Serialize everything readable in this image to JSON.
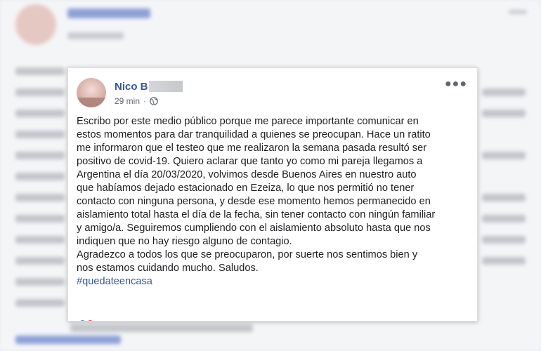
{
  "post": {
    "author": "Nico B",
    "timestamp": "29 min",
    "separator": "·",
    "audience_icon": "globe-icon",
    "more_icon": "more-options-icon",
    "body": {
      "paragraph1_lines": [
        "Escribo por este medio público porque me parece importante comunicar en",
        "estos momentos para dar tranquilidad a quienes se preocupan. Hace un ratito",
        "me informaron que el testeo que me realizaron la semana pasada resultó ser",
        "positivo de covid-19. Quiero aclarar que tanto yo como mi pareja llegamos a",
        "Argentina el día 20/03/2020, volvimos desde Buenos Aires en nuestro auto",
        "que habíamos dejado estacionado en Ezeiza, lo que nos permitió no tener",
        "contacto con ninguna persona, y desde ese momento hemos permanecido en",
        "aislamiento total hasta el día de la fecha, sin tener contacto con ningún familiar",
        "y amigo/a. Seguiremos cumpliendo con el aislamiento absoluto hasta que nos",
        "indiquen que no hay riesgo alguno de contagio."
      ],
      "paragraph2_lines": [
        "Agradezco a todos los que se preocuparon, por suerte nos sentimos bien y",
        "nos estamos cuidando mucho. Saludos."
      ],
      "hashtag": "#quedateencasa"
    }
  },
  "colors": {
    "author": "#365899",
    "hashtag": "#385898",
    "text": "#1c1e21",
    "meta": "#606770"
  }
}
